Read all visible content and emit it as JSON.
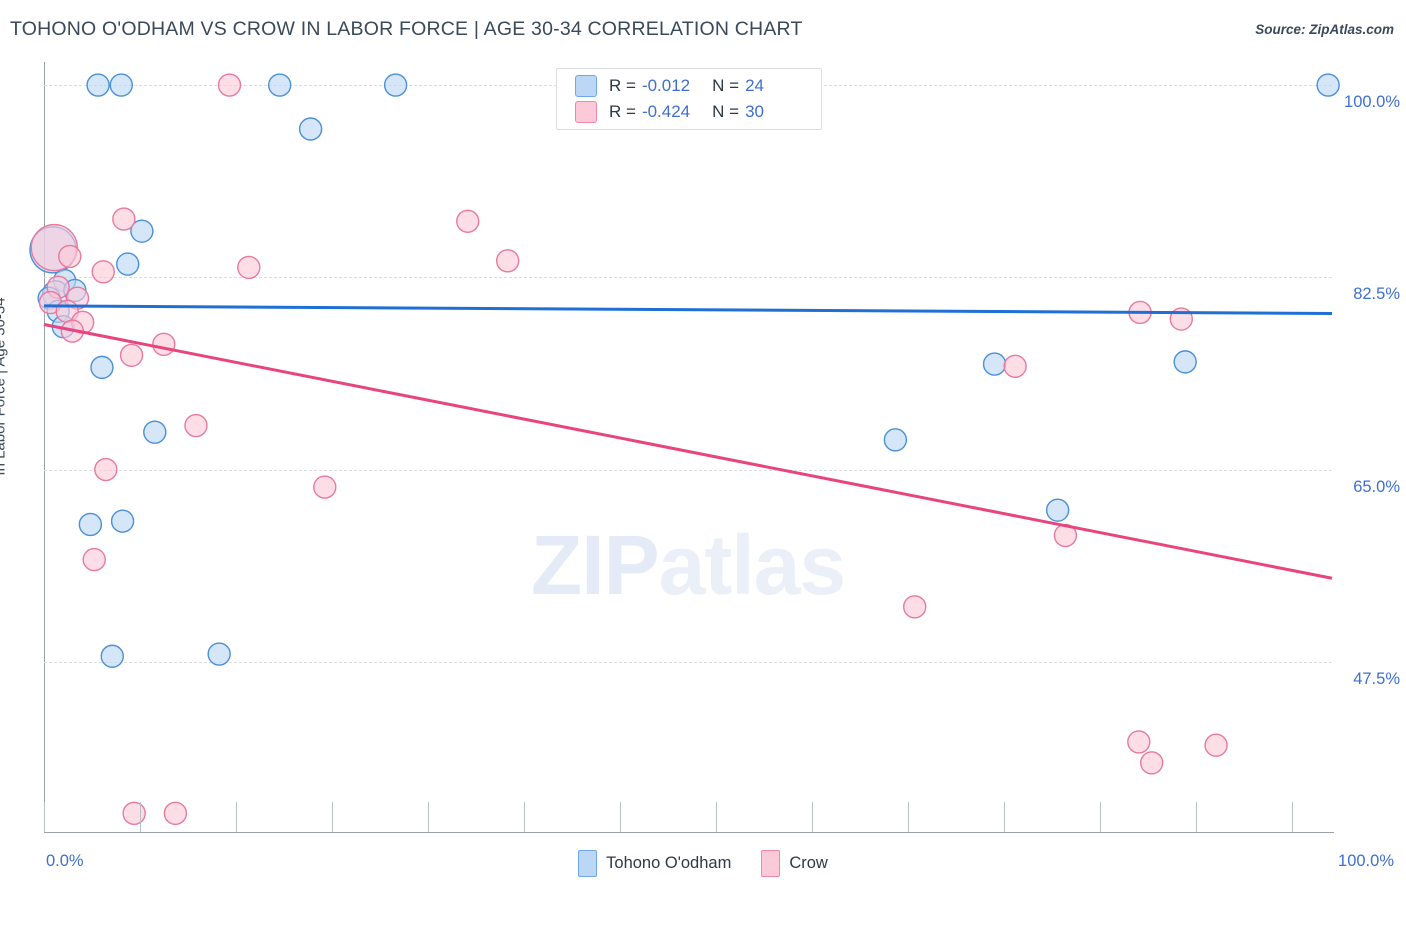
{
  "header": {
    "title": "TOHONO O'ODHAM VS CROW IN LABOR FORCE | AGE 30-34 CORRELATION CHART",
    "source": "Source: ZipAtlas.com"
  },
  "legend": {
    "rows": [
      {
        "series": "Tohono O'odham",
        "r_key": "R =",
        "r_value": "-0.012",
        "n_key": "N =",
        "n_value": "24",
        "color": "#bcd7f5"
      },
      {
        "series": "Crow",
        "r_key": "R =",
        "r_value": "-0.424",
        "n_key": "N =",
        "n_value": "30",
        "color": "#fbc9d8"
      }
    ]
  },
  "bottom_legend": [
    {
      "label": "Tohono O'odham",
      "color": "#bcd7f5",
      "border": "#6fa8e8"
    },
    {
      "label": "Crow",
      "color": "#fbc9d8",
      "border": "#ef87a9"
    }
  ],
  "axes": {
    "y_label": "In Labor Force | Age 30-34",
    "y_ticks": [
      "100.0%",
      "82.5%",
      "65.0%",
      "47.5%"
    ],
    "x_min_label": "0.0%",
    "x_max_label": "100.0%"
  },
  "watermark": {
    "zip": "ZIP",
    "atlas": "atlas"
  },
  "chart_data": {
    "type": "scatter",
    "title": "TOHONO O'ODHAM VS CROW IN LABOR FORCE | AGE 30-34 CORRELATION CHART",
    "xlabel": "",
    "ylabel": "In Labor Force | Age 30-34",
    "xlim": [
      0,
      100
    ],
    "ylim": [
      32.0,
      102.1
    ],
    "x_ticks": [
      0,
      100
    ],
    "y_ticks": [
      47.5,
      65.0,
      82.5,
      100.0
    ],
    "grid": true,
    "legend_position": "top-center",
    "series": [
      {
        "name": "Tohono O'odham",
        "color": "#bcd7f5",
        "border": "#4a90d9",
        "R": -0.012,
        "N": 24,
        "trendline": {
          "x0": 0,
          "y0": 79.9,
          "x1": 100,
          "y1": 79.2
        },
        "points": [
          {
            "x": 4.2,
            "y": 100.0,
            "r": 11
          },
          {
            "x": 6.0,
            "y": 100.0,
            "r": 11
          },
          {
            "x": 18.3,
            "y": 100.0,
            "r": 11
          },
          {
            "x": 27.3,
            "y": 100.0,
            "r": 11
          },
          {
            "x": 99.7,
            "y": 100.0,
            "r": 11
          },
          {
            "x": 20.7,
            "y": 96.0,
            "r": 11
          },
          {
            "x": 7.6,
            "y": 86.7,
            "r": 11
          },
          {
            "x": 0.7,
            "y": 85.0,
            "r": 23
          },
          {
            "x": 6.5,
            "y": 83.7,
            "r": 11
          },
          {
            "x": 1.6,
            "y": 82.2,
            "r": 11
          },
          {
            "x": 0.9,
            "y": 81.0,
            "r": 13
          },
          {
            "x": 2.4,
            "y": 81.3,
            "r": 11
          },
          {
            "x": 0.4,
            "y": 80.6,
            "r": 11
          },
          {
            "x": 1.1,
            "y": 79.4,
            "r": 11
          },
          {
            "x": 1.5,
            "y": 78.0,
            "r": 11
          },
          {
            "x": 4.5,
            "y": 74.3,
            "r": 11
          },
          {
            "x": 8.6,
            "y": 68.4,
            "r": 11
          },
          {
            "x": 3.6,
            "y": 60.0,
            "r": 11
          },
          {
            "x": 6.1,
            "y": 60.3,
            "r": 11
          },
          {
            "x": 78.7,
            "y": 61.3,
            "r": 11
          },
          {
            "x": 66.1,
            "y": 67.7,
            "r": 11
          },
          {
            "x": 73.8,
            "y": 74.6,
            "r": 11
          },
          {
            "x": 88.6,
            "y": 74.8,
            "r": 11
          },
          {
            "x": 5.3,
            "y": 48.0,
            "r": 11
          },
          {
            "x": 13.6,
            "y": 48.2,
            "r": 11
          }
        ]
      },
      {
        "name": "Crow",
        "color": "#fbc9d8",
        "border": "#e8799f",
        "R": -0.424,
        "N": 30,
        "trendline": {
          "x0": 0,
          "y0": 78.2,
          "x1": 100,
          "y1": 55.1
        },
        "points": [
          {
            "x": 14.4,
            "y": 100.0,
            "r": 11
          },
          {
            "x": 6.2,
            "y": 87.8,
            "r": 11
          },
          {
            "x": 32.9,
            "y": 87.6,
            "r": 11
          },
          {
            "x": 0.8,
            "y": 85.2,
            "r": 23
          },
          {
            "x": 2.0,
            "y": 84.4,
            "r": 11
          },
          {
            "x": 36.0,
            "y": 84.0,
            "r": 11
          },
          {
            "x": 15.9,
            "y": 83.4,
            "r": 11
          },
          {
            "x": 4.6,
            "y": 83.0,
            "r": 11
          },
          {
            "x": 1.1,
            "y": 81.6,
            "r": 11
          },
          {
            "x": 2.6,
            "y": 80.6,
            "r": 11
          },
          {
            "x": 0.5,
            "y": 80.2,
            "r": 11
          },
          {
            "x": 1.8,
            "y": 79.4,
            "r": 11
          },
          {
            "x": 3.0,
            "y": 78.4,
            "r": 11
          },
          {
            "x": 2.2,
            "y": 77.6,
            "r": 11
          },
          {
            "x": 9.3,
            "y": 76.4,
            "r": 11
          },
          {
            "x": 6.8,
            "y": 75.4,
            "r": 11
          },
          {
            "x": 11.8,
            "y": 69.0,
            "r": 11
          },
          {
            "x": 4.8,
            "y": 65.0,
            "r": 11
          },
          {
            "x": 21.8,
            "y": 63.4,
            "r": 11
          },
          {
            "x": 3.9,
            "y": 56.8,
            "r": 11
          },
          {
            "x": 79.3,
            "y": 59.0,
            "r": 11
          },
          {
            "x": 75.4,
            "y": 74.4,
            "r": 11
          },
          {
            "x": 85.1,
            "y": 79.3,
            "r": 11
          },
          {
            "x": 88.3,
            "y": 78.7,
            "r": 11
          },
          {
            "x": 67.6,
            "y": 52.5,
            "r": 11
          },
          {
            "x": 85.0,
            "y": 40.2,
            "r": 11
          },
          {
            "x": 86.0,
            "y": 38.3,
            "r": 11
          },
          {
            "x": 91.0,
            "y": 39.9,
            "r": 11
          },
          {
            "x": 7.0,
            "y": 33.7,
            "r": 11
          },
          {
            "x": 10.2,
            "y": 33.7,
            "r": 11
          }
        ]
      }
    ]
  }
}
